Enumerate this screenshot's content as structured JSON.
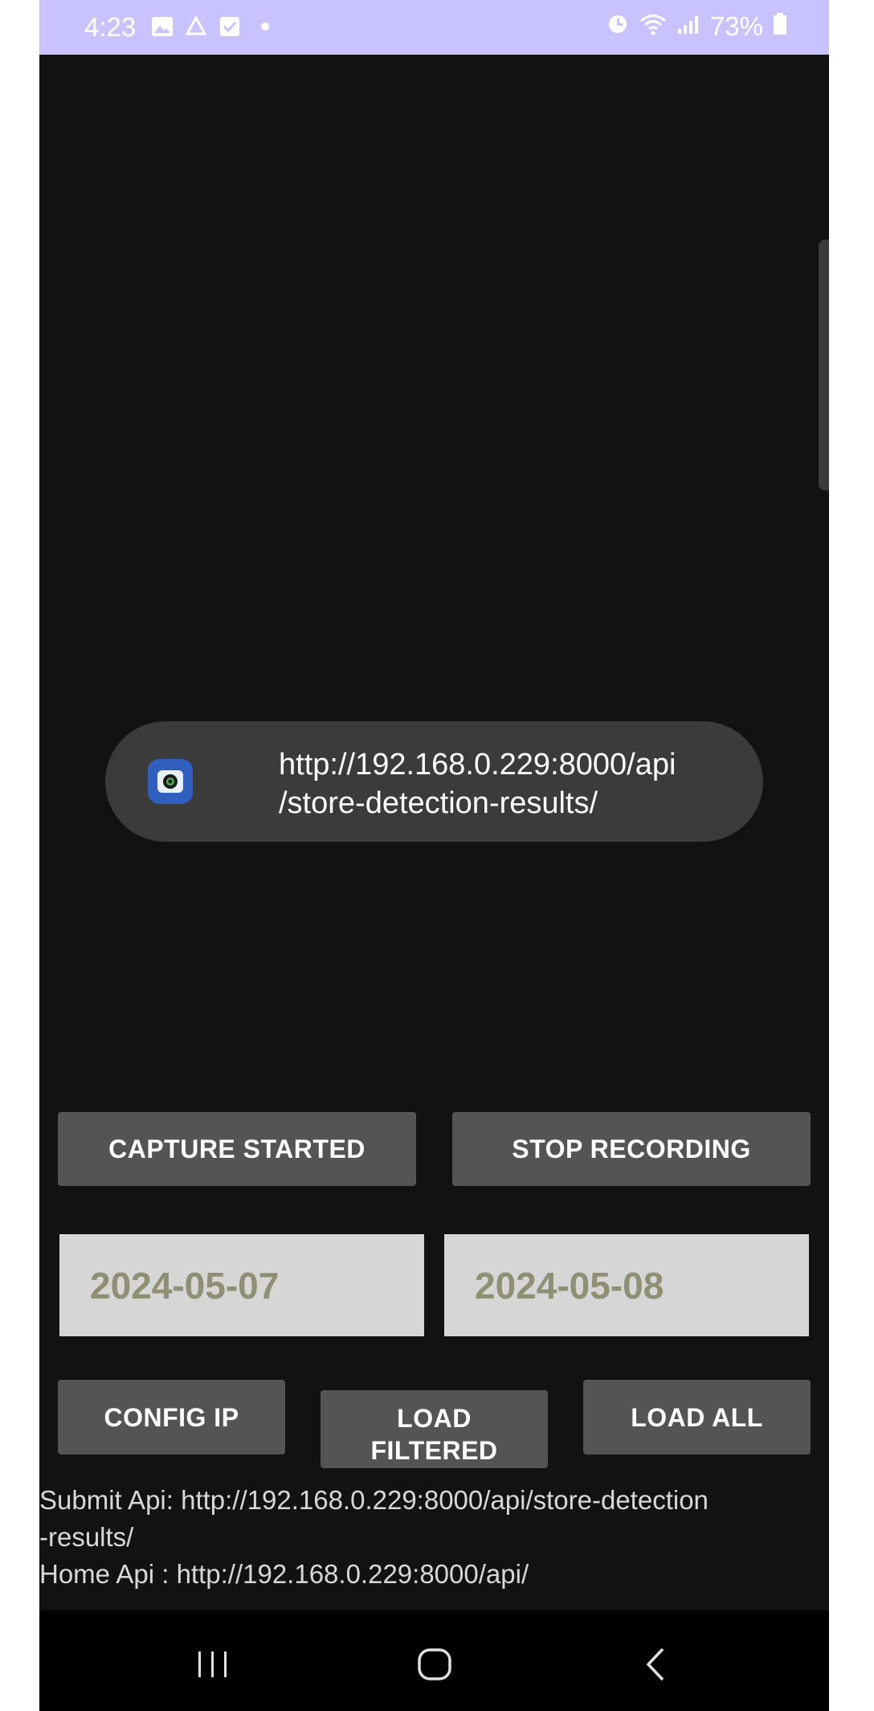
{
  "status_bar": {
    "time": "4:23",
    "left_icons": [
      "image-icon",
      "recycle-icon",
      "checkbox-icon",
      "dot-icon"
    ],
    "right_icons": [
      "alarm-icon",
      "wifi-icon",
      "signal-icon",
      "battery-icon"
    ],
    "battery": "73%"
  },
  "toast": {
    "icon": "camera-app-icon",
    "line1": "http://192.168.0.229:8000/api",
    "line2": "/store-detection-results/"
  },
  "buttons": {
    "capture": "CAPTURE STARTED",
    "stop": "STOP RECORDING",
    "config_ip": "CONFIG IP",
    "load_filtered_line1": "LOAD",
    "load_filtered_line2": "FILTERED",
    "load_all": "LOAD ALL"
  },
  "dates": {
    "start": "2024-05-07",
    "end": "2024-05-08"
  },
  "info": {
    "submit_line1": "Submit Api: http://192.168.0.229:8000/api/store-detection",
    "submit_line2": "-results/",
    "home": "Home Api : http://192.168.0.229:8000/api/"
  },
  "nav_bar": {
    "icons": [
      "recent-apps-icon",
      "home-icon",
      "back-icon"
    ]
  },
  "colors": {
    "background": "#121212",
    "status_bar": "#c8c2ff",
    "button": "#545454",
    "date_field": "#d6d6d6",
    "date_text": "#8f8f74"
  }
}
